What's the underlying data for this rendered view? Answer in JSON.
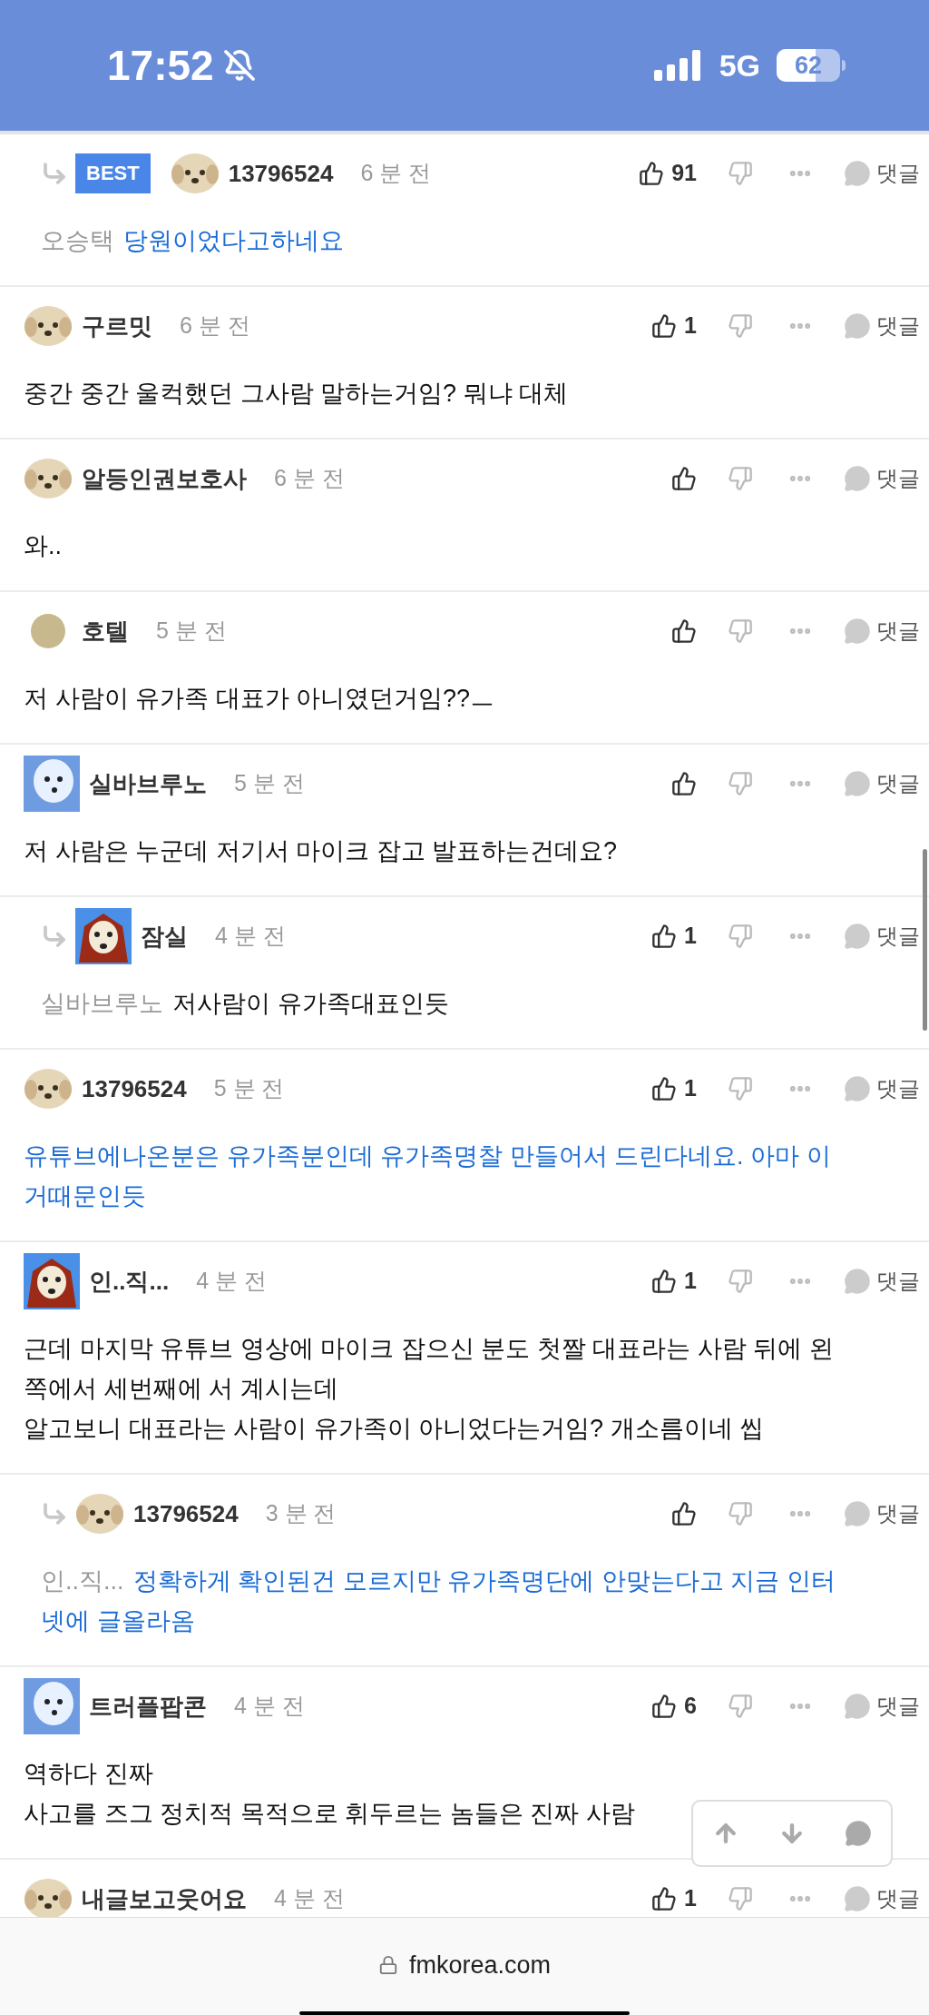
{
  "status_bar": {
    "time": "17:52",
    "network": "5G",
    "battery": "62"
  },
  "comments": [
    {
      "reply": true,
      "best": "BEST",
      "avatar": {
        "kind": "puppy"
      },
      "name": "13796524",
      "time": "6 분 전",
      "likes": "91",
      "reply_label": "댓글",
      "mention": "오승택",
      "text": [
        "당원이었다고하네요"
      ],
      "highlighted": true
    },
    {
      "reply": false,
      "avatar": {
        "kind": "puppy"
      },
      "name": "구르밋",
      "time": "6 분 전",
      "likes": "1",
      "reply_label": "댓글",
      "text": [
        "중간 중간 울컥했던 그사람 말하는거임? 뭐냐 대체"
      ],
      "highlighted": false
    },
    {
      "reply": false,
      "avatar": {
        "kind": "puppy"
      },
      "name": "알등인권보호사",
      "time": "6 분 전",
      "reply_label": "댓글",
      "text": [
        "와.."
      ],
      "highlighted": false
    },
    {
      "reply": false,
      "avatar": {
        "kind": "plain"
      },
      "name": "호텔",
      "time": "5 분 전",
      "reply_label": "댓글",
      "text": [
        "저 사람이 유가족 대표가 아니였던거임??ㅡ"
      ],
      "highlighted": false
    },
    {
      "reply": false,
      "avatar": {
        "kind": "blue-dog"
      },
      "name": "실바브루노",
      "time": "5 분 전",
      "reply_label": "댓글",
      "text": [
        "저 사람은 누군데 저기서 마이크 잡고 발표하는건데요?"
      ],
      "highlighted": false
    },
    {
      "reply": true,
      "avatar": {
        "kind": "red-dog"
      },
      "name": "잠실",
      "time": "4 분 전",
      "likes": "1",
      "reply_label": "댓글",
      "mention": "실바브루노",
      "text": [
        "저사람이 유가족대표인듯"
      ],
      "highlighted": false
    },
    {
      "reply": false,
      "avatar": {
        "kind": "puppy"
      },
      "name": "13796524",
      "time": "5 분 전",
      "likes": "1",
      "reply_label": "댓글",
      "text": [
        "유튜브에나온분은 유가족분인데 유가족명찰 만들어서 드린다네요. 아마 이",
        "거때문인듯"
      ],
      "highlighted": true
    },
    {
      "reply": false,
      "avatar": {
        "kind": "red-dog"
      },
      "name": "인..직...",
      "time": "4 분 전",
      "likes": "1",
      "reply_label": "댓글",
      "text": [
        "근데 마지막 유튜브 영상에 마이크 잡으신 분도 첫짤 대표라는 사람 뒤에 왼",
        "쪽에서 세번째에 서 계시는데",
        "알고보니 대표라는 사람이 유가족이 아니었다는거임? 개소름이네 씹"
      ],
      "highlighted": false
    },
    {
      "reply": true,
      "avatar": {
        "kind": "puppy"
      },
      "name": "13796524",
      "time": "3 분 전",
      "reply_label": "댓글",
      "mention": "인..직...",
      "text": [
        "정확하게 확인된건 모르지만 유가족명단에 안맞는다고 지금 인터",
        "넷에 글올라옴"
      ],
      "highlighted": true
    },
    {
      "reply": false,
      "avatar": {
        "kind": "blue-dog"
      },
      "name": "트러플팝콘",
      "time": "4 분 전",
      "likes": "6",
      "reply_label": "댓글",
      "text": [
        "역하다 진짜",
        "사고를 즈그 정치적 목적으로 휘두르는 놈들은 진짜 사람"
      ],
      "highlighted": false
    },
    {
      "reply": false,
      "avatar": {
        "kind": "puppy"
      },
      "name": "내글보고웃어요",
      "time": "4 분 전",
      "likes": "1",
      "reply_label": "댓글"
    }
  ],
  "address_bar": {
    "url": "fmkorea.com"
  }
}
